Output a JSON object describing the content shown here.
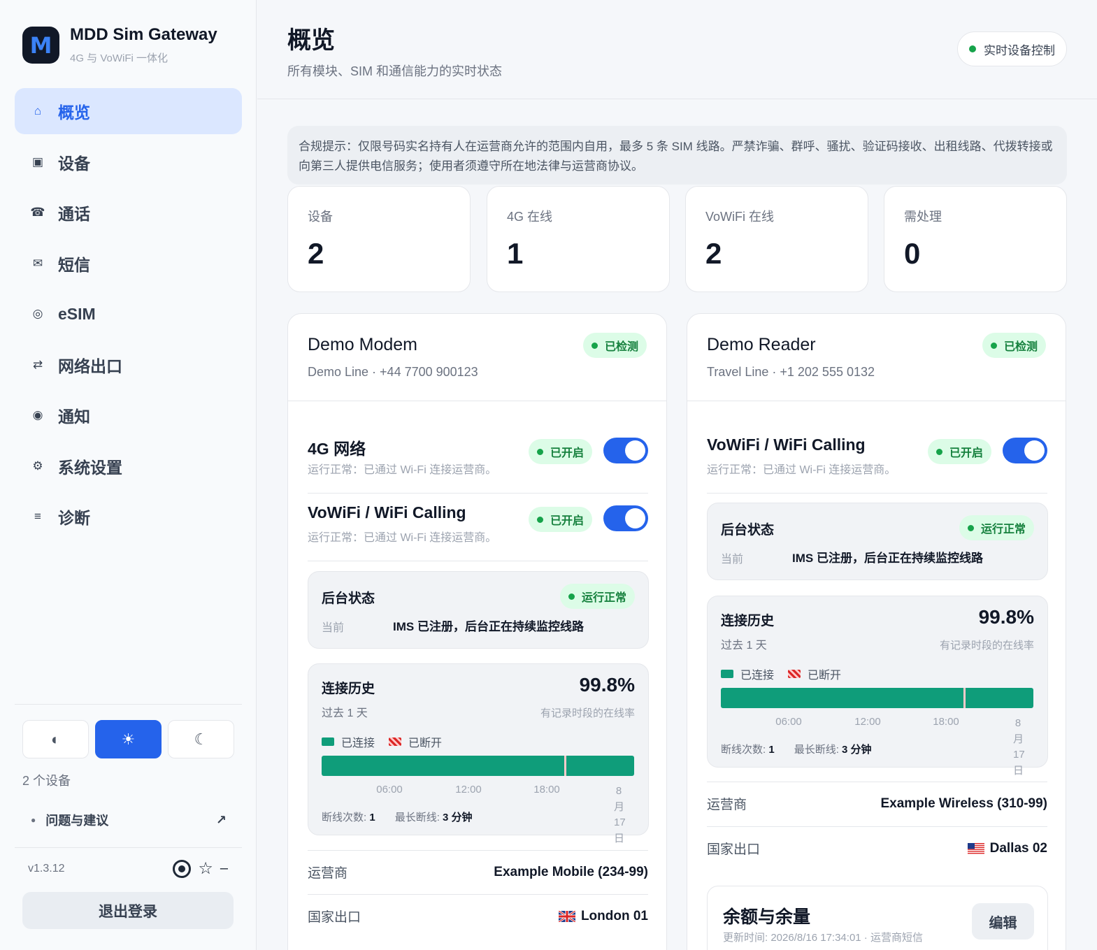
{
  "app": {
    "logo_letter": "M",
    "title": "MDD Sim Gateway",
    "subtitle": "4G 与 VoWiFi 一体化"
  },
  "sidebar": {
    "items": [
      {
        "label": "概览",
        "icon": "home-icon",
        "glyph": "⌂",
        "active": true
      },
      {
        "label": "设备",
        "icon": "device-icon",
        "glyph": "▣",
        "active": false
      },
      {
        "label": "通话",
        "icon": "phone-icon",
        "glyph": "☎",
        "active": false
      },
      {
        "label": "短信",
        "icon": "mail-icon",
        "glyph": "✉",
        "active": false
      },
      {
        "label": "eSIM",
        "icon": "esim-icon",
        "glyph": "◎",
        "active": false
      },
      {
        "label": "网络出口",
        "icon": "swap-icon",
        "glyph": "⇄",
        "active": false
      },
      {
        "label": "通知",
        "icon": "bell-icon",
        "glyph": "◉",
        "active": false
      },
      {
        "label": "系统设置",
        "icon": "gear-icon",
        "glyph": "⚙",
        "active": false
      },
      {
        "label": "诊断",
        "icon": "list-icon",
        "glyph": "≡",
        "active": false
      }
    ],
    "theme": {
      "auto_glyph": "◐",
      "light_glyph": "☀",
      "dark_glyph": "☾",
      "active": "light"
    },
    "device_count": "2 个设备",
    "feedback_label": "问题与建议",
    "feedback_arrow": "↗",
    "version": "v1.3.12",
    "star_glyph": "☆",
    "star_count": "–",
    "logout_label": "退出登录"
  },
  "header": {
    "title": "概览",
    "subtitle": "所有模块、SIM 和通信能力的实时状态",
    "live_button": "实时设备控制"
  },
  "notice": "合规提示：仅限号码实名持有人在运营商允许的范围内自用，最多 5 条 SIM 线路。严禁诈骗、群呼、骚扰、验证码接收、出租线路、代拨转接或向第三人提供电信服务；使用者须遵守所在地法律与运营商协议。",
  "stats": [
    {
      "label": "设备",
      "value": "2"
    },
    {
      "label": "4G 在线",
      "value": "1"
    },
    {
      "label": "VoWiFi 在线",
      "value": "2"
    },
    {
      "label": "需处理",
      "value": "0"
    }
  ],
  "colors": {
    "accent": "#2563eb",
    "connected": "#0f9d7a",
    "disconnected": "#dc2626",
    "ok": "#16a34a"
  },
  "devices": [
    {
      "name": "Demo Modem",
      "line": "Demo Line · +44 7700 900123",
      "detected_badge": "已检测",
      "services": [
        {
          "title": "4G 网络",
          "desc": "运行正常：已通过 Wi-Fi 连接运营商。",
          "badge": "已开启",
          "enabled": true
        },
        {
          "title": "VoWiFi / WiFi Calling",
          "desc": "运行正常：已通过 Wi-Fi 连接运营商。",
          "badge": "已开启",
          "enabled": true
        }
      ],
      "background": {
        "title": "后台状态",
        "badge": "运行正常",
        "current_label": "当前",
        "current_value": "IMS 已注册，后台正在持续监控线路"
      },
      "history": {
        "title": "连接历史",
        "range": "过去 1 天",
        "uptime": "99.8%",
        "uptime_label": "有记录时段的在线率",
        "legend_connected": "已连接",
        "legend_disconnected": "已断开",
        "ticks": [
          "06:00",
          "12:00",
          "18:00"
        ],
        "end_tick": "8月17日",
        "outage_at": 0.777,
        "drops_label": "断线次数:",
        "drops": "1",
        "longest_label": "最长断线:",
        "longest": "3 分钟"
      },
      "carrier_label": "运营商",
      "carrier": "Example Mobile (234-99)",
      "exit_label": "国家出口",
      "exit": "London 01",
      "exit_flag": "uk-flag-icon"
    },
    {
      "name": "Demo Reader",
      "line": "Travel Line · +1 202 555 0132",
      "detected_badge": "已检测",
      "services": [
        {
          "title": "VoWiFi / WiFi Calling",
          "desc": "运行正常：已通过 Wi-Fi 连接运营商。",
          "badge": "已开启",
          "enabled": true
        }
      ],
      "background": {
        "title": "后台状态",
        "badge": "运行正常",
        "current_label": "当前",
        "current_value": "IMS 已注册，后台正在持续监控线路"
      },
      "history": {
        "title": "连接历史",
        "range": "过去 1 天",
        "uptime": "99.8%",
        "uptime_label": "有记录时段的在线率",
        "legend_connected": "已连接",
        "legend_disconnected": "已断开",
        "ticks": [
          "06:00",
          "12:00",
          "18:00"
        ],
        "end_tick": "8月17日",
        "outage_at": 0.777,
        "drops_label": "断线次数:",
        "drops": "1",
        "longest_label": "最长断线:",
        "longest": "3 分钟"
      },
      "carrier_label": "运营商",
      "carrier": "Example Wireless (310-99)",
      "exit_label": "国家出口",
      "exit": "Dallas 02",
      "exit_flag": "us-flag-icon",
      "balance": {
        "title": "余额与余量",
        "updated": "更新时间: 2026/8/16 17:34:01 · 运营商短信",
        "edit_label": "编辑"
      }
    }
  ]
}
